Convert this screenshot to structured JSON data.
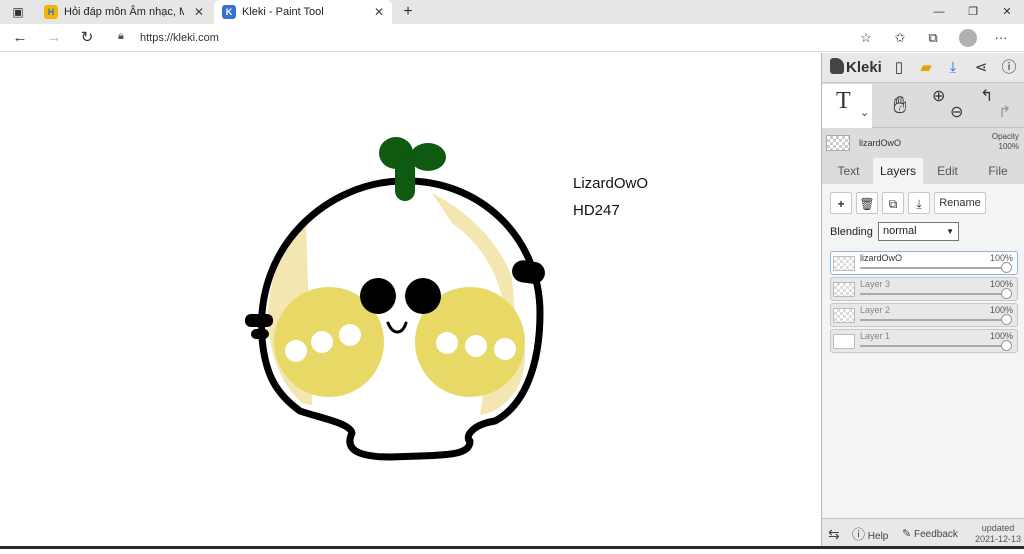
{
  "browser": {
    "tabs": [
      {
        "title": "Hỏi đáp môn Âm nhạc, Mỹ thuật",
        "favicon": "H",
        "close": "✕"
      },
      {
        "title": "Kleki - Paint Tool",
        "favicon": "K",
        "close": "✕"
      }
    ],
    "new_tab": "+",
    "window_controls": {
      "minimize": "—",
      "maximize": "❐",
      "close": "✕"
    },
    "url": "https://kleki.com",
    "nav": {
      "back": "←",
      "forward": "→",
      "refresh": "↻"
    },
    "toolbar_icons": [
      "favorites-add-icon",
      "favorites-icon",
      "collections-icon",
      "profile-icon",
      "more-icon"
    ],
    "more": "···"
  },
  "canvas": {
    "texts": [
      "LizardOwO",
      "HD247"
    ],
    "colors": {
      "outline": "#000000",
      "cheek": "#e8d966",
      "stripe": "#f3e6b0",
      "sprout": "#0d5a10"
    }
  },
  "kleki": {
    "logo": "Kleki",
    "header_icons": [
      "new-image-icon",
      "open-folder-icon",
      "save-download-icon",
      "share-icon",
      "help-icon"
    ],
    "tools": {
      "text": "T",
      "text_arrow": "⌄"
    },
    "current_layer": {
      "name": "lizardOwO",
      "opacity_label": "Opacity",
      "opacity": "100%"
    },
    "tabs": [
      "Text",
      "Layers",
      "Edit",
      "File"
    ],
    "active_tab": "Layers",
    "layer_buttons": {
      "add": "+",
      "rename": "Rename"
    },
    "blending_label": "Blending",
    "blending_value": "normal",
    "layers": [
      {
        "name": "lizardOwO",
        "opacity": "100%",
        "selected": true
      },
      {
        "name": "Layer 3",
        "opacity": "100%",
        "selected": false
      },
      {
        "name": "Layer 2",
        "opacity": "100%",
        "selected": false
      },
      {
        "name": "Layer 1",
        "opacity": "100%",
        "selected": false
      }
    ],
    "footer": {
      "help": "Help",
      "feedback": "Feedback",
      "updated_label": "updated",
      "updated_date": "2021-12-13"
    }
  }
}
